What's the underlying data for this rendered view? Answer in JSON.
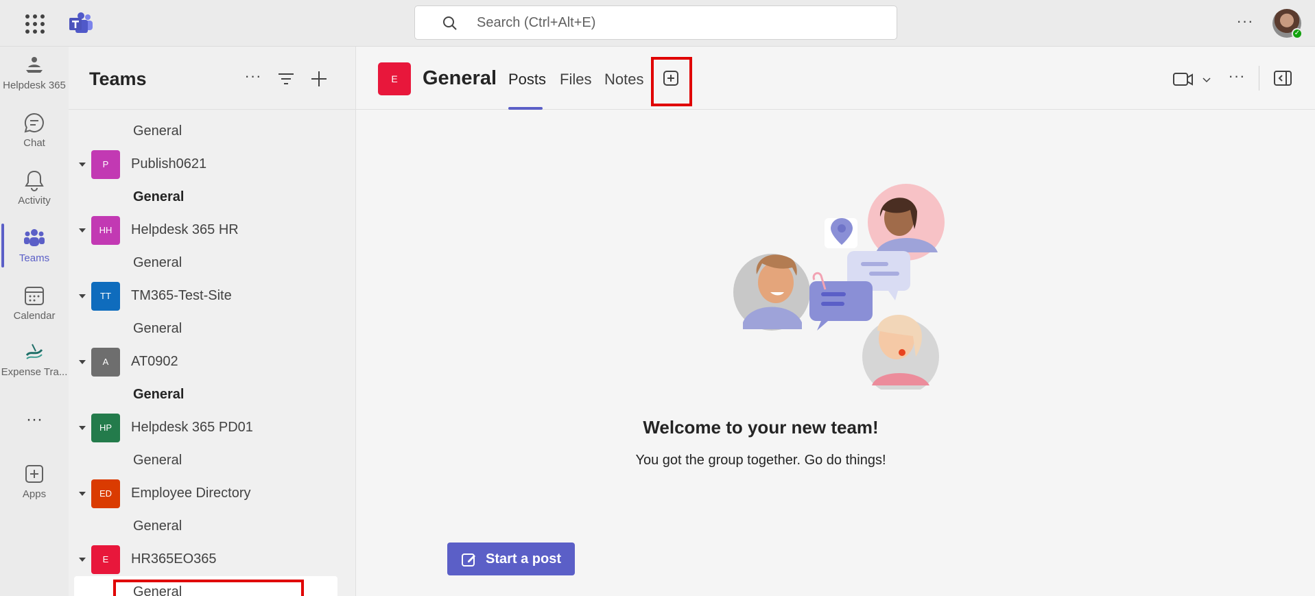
{
  "topbar": {
    "search_placeholder": "Search (Ctrl+Alt+E)",
    "more_label": "···"
  },
  "rail": {
    "items": [
      {
        "label": "Helpdesk 365",
        "icon": "helpdesk-icon"
      },
      {
        "label": "Chat",
        "icon": "chat-icon"
      },
      {
        "label": "Activity",
        "icon": "bell-icon"
      },
      {
        "label": "Teams",
        "icon": "teams-icon"
      },
      {
        "label": "Calendar",
        "icon": "calendar-icon"
      },
      {
        "label": "Expense Tra...",
        "icon": "expense-icon"
      },
      {
        "label": "Apps",
        "icon": "apps-icon"
      }
    ],
    "more_label": "···"
  },
  "teams_panel": {
    "title": "Teams",
    "more_label": "···",
    "rows": [
      {
        "type": "channel",
        "name": "General",
        "bold": false
      },
      {
        "type": "team",
        "name": "Publish0621",
        "initials": "P",
        "color": "#c239b3"
      },
      {
        "type": "channel",
        "name": "General",
        "bold": true
      },
      {
        "type": "team",
        "name": "Helpdesk 365 HR",
        "initials": "HH",
        "color": "#c239b3"
      },
      {
        "type": "channel",
        "name": "General",
        "bold": false
      },
      {
        "type": "team",
        "name": "TM365-Test-Site",
        "initials": "TT",
        "color": "#0f6cbd"
      },
      {
        "type": "channel",
        "name": "General",
        "bold": false
      },
      {
        "type": "team",
        "name": "AT0902",
        "initials": "A",
        "color": "#6e6e6e"
      },
      {
        "type": "channel",
        "name": "General",
        "bold": true
      },
      {
        "type": "team",
        "name": "Helpdesk 365 PD01",
        "initials": "HP",
        "color": "#237b4b"
      },
      {
        "type": "channel",
        "name": "General",
        "bold": false
      },
      {
        "type": "team",
        "name": "Employee Directory",
        "initials": "ED",
        "color": "#da3b01"
      },
      {
        "type": "channel",
        "name": "General",
        "bold": false
      },
      {
        "type": "team",
        "name": "HR365EO365",
        "initials": "E",
        "color": "#e8173b"
      },
      {
        "type": "channel",
        "name": "General",
        "bold": false,
        "selected": true
      }
    ]
  },
  "main": {
    "channel_initial": "E",
    "channel_title": "General",
    "tabs": [
      "Posts",
      "Files",
      "Notes"
    ],
    "more_label": "···",
    "welcome_title": "Welcome to your new team!",
    "welcome_subtitle": "You got the group together. Go do things!",
    "start_post_label": "Start a post",
    "accent_color": "#5b5fc7"
  }
}
